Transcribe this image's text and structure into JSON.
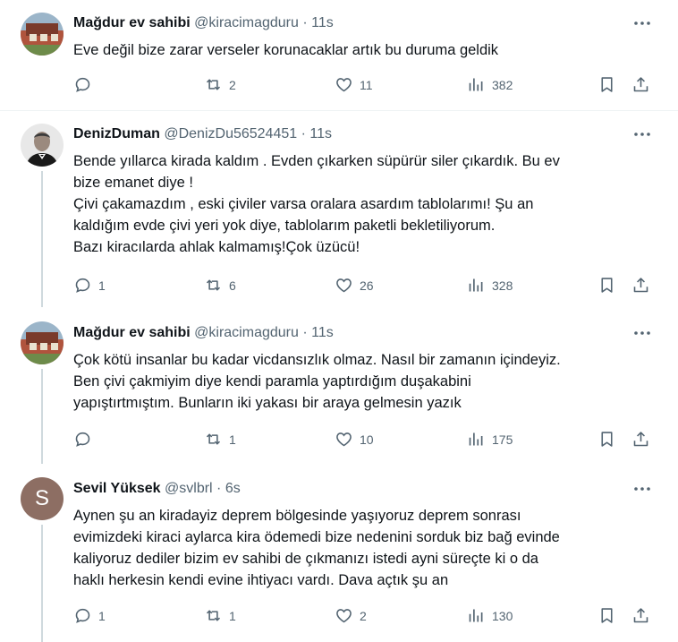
{
  "tweets": [
    {
      "name": "Mağdur ev sahibi",
      "handle": "@kiracimagduru",
      "separator": "·",
      "time": "11s",
      "lines": [
        "Eve değil bize zarar verseler korunacaklar artık bu duruma geldik"
      ],
      "replies": "",
      "retweets": "2",
      "likes": "11",
      "views": "382"
    },
    {
      "name": "DenizDuman",
      "handle": "@DenizDu56524451",
      "separator": "·",
      "time": "11s",
      "lines": [
        "Bende yıllarca kirada kaldım . Evden çıkarken süpürür siler çıkardık. Bu ev",
        "bize emanet diye !",
        "Çivi çakamazdım , eski çiviler varsa oralara asardım tablolarımı! Şu an",
        "kaldığım evde çivi yeri yok diye, tablolarım paketli bekletiliyorum.",
        "Bazı kiracılarda ahlak kalmamış!Çok üzücü!"
      ],
      "replies": "1",
      "retweets": "6",
      "likes": "26",
      "views": "328"
    },
    {
      "name": "Mağdur ev sahibi",
      "handle": "@kiracimagduru",
      "separator": "·",
      "time": "11s",
      "lines": [
        "Çok kötü insanlar bu kadar vicdansızlık olmaz. Nasıl bir zamanın içindeyiz.",
        "Ben çivi çakmiyim diye kendi paramla yaptırdığım duşakabini",
        "yapıştırtmıştım. Bunların iki yakası bir araya gelmesin yazık"
      ],
      "replies": "",
      "retweets": "1",
      "likes": "10",
      "views": "175"
    },
    {
      "name": "Sevil Yüksek",
      "handle": "@svlbrl",
      "separator": "·",
      "time": "6s",
      "avatar_letter": "S",
      "lines": [
        "Aynen şu an kiradayiz deprem bölgesinde yaşıyoruz deprem sonrası",
        "evimizdeki kiraci aylarca kira ödemedi bize nedenini sorduk biz bağ evinde",
        "kaliyoruz dediler bizim ev sahibi de çıkmanızı istedi ayni süreçte ki o da",
        "haklı herkesin kendi evine ihtiyacı vardı. Dava açtık şu an"
      ],
      "replies": "1",
      "retweets": "1",
      "likes": "2",
      "views": "130"
    }
  ],
  "colors": {
    "text": "#0f1419",
    "muted": "#536471",
    "separator": "#eff3f4",
    "thread": "#cfd9de"
  }
}
